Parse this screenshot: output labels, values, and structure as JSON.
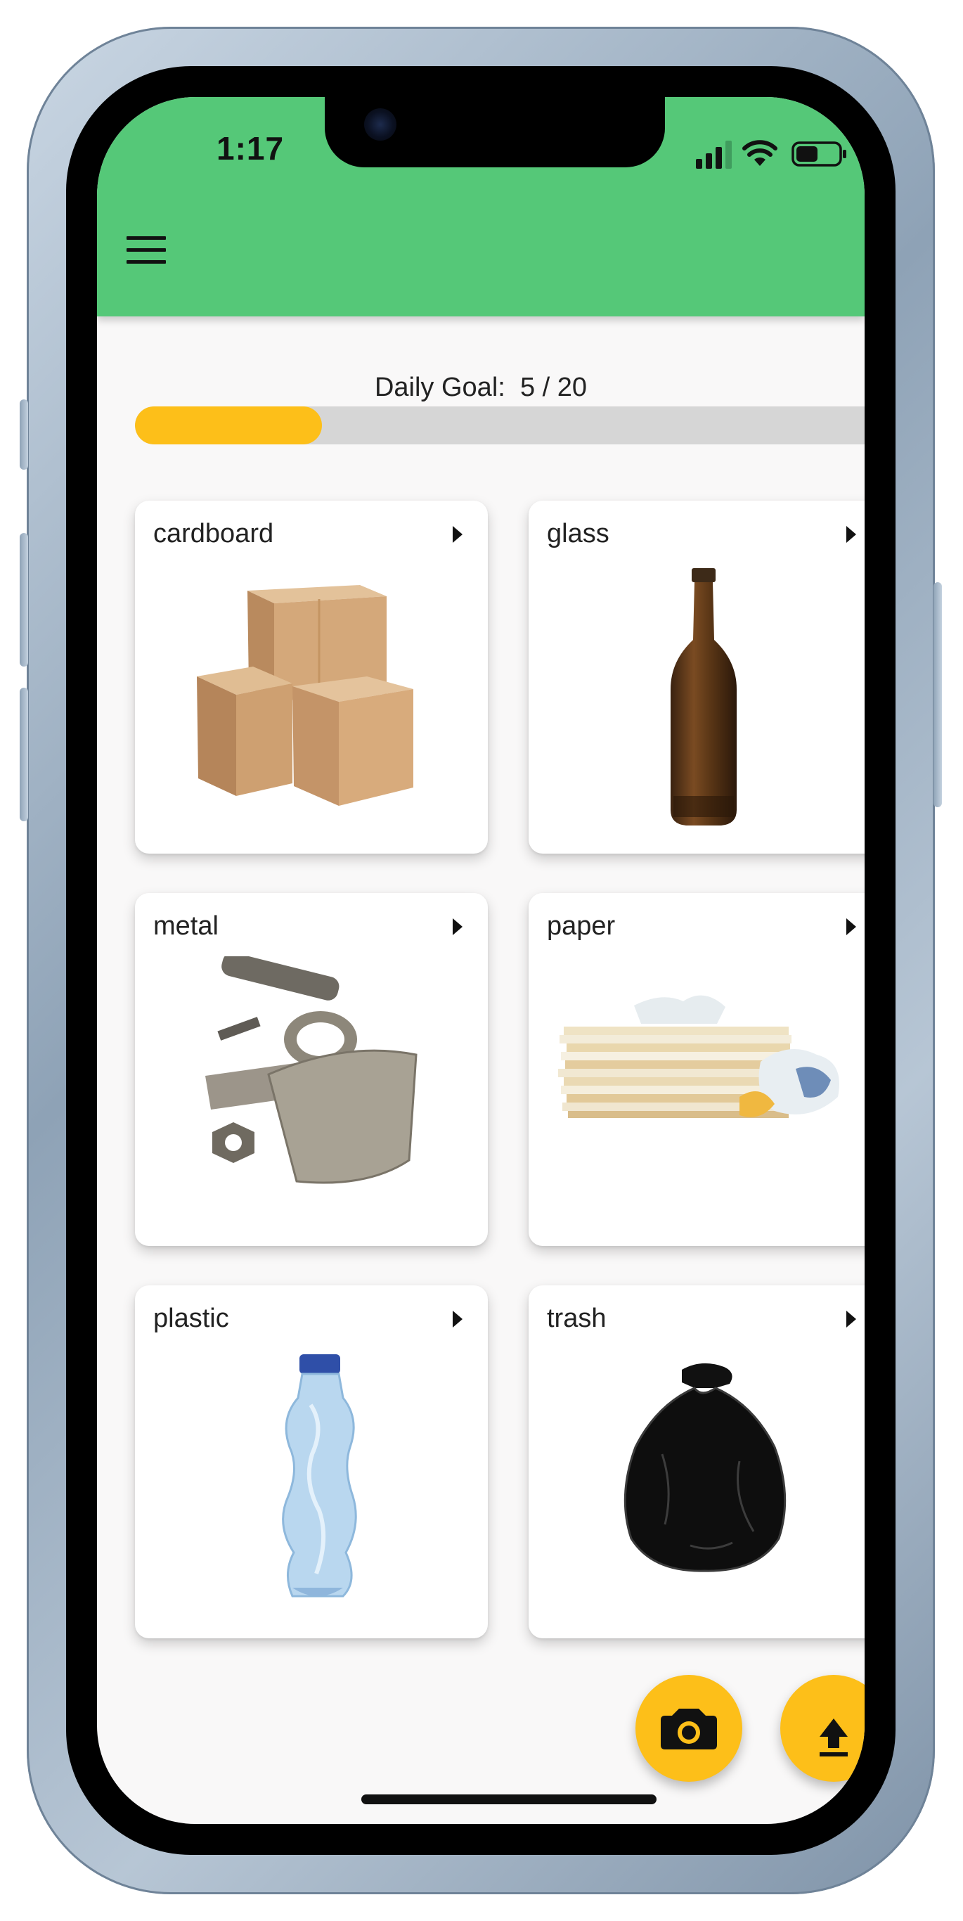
{
  "status_bar": {
    "time": "1:17"
  },
  "app_bar": {
    "menu_icon": "hamburger-menu-icon",
    "color": "#55c878"
  },
  "daily_goal": {
    "label": "Daily Goal:",
    "value_text": "5 / 20",
    "current": 5,
    "target": 20,
    "progress_fraction": 0.25,
    "fill_color": "#fdbf19"
  },
  "categories": [
    {
      "label": "cardboard",
      "icon": "cardboard-boxes-image"
    },
    {
      "label": "glass",
      "icon": "glass-bottle-image"
    },
    {
      "label": "metal",
      "icon": "metal-scrap-image"
    },
    {
      "label": "paper",
      "icon": "paper-stack-image"
    },
    {
      "label": "plastic",
      "icon": "plastic-bottle-image"
    },
    {
      "label": "trash",
      "icon": "trash-bag-image"
    }
  ],
  "actions": [
    {
      "icon": "camera-icon"
    },
    {
      "icon": "upload-icon"
    }
  ]
}
